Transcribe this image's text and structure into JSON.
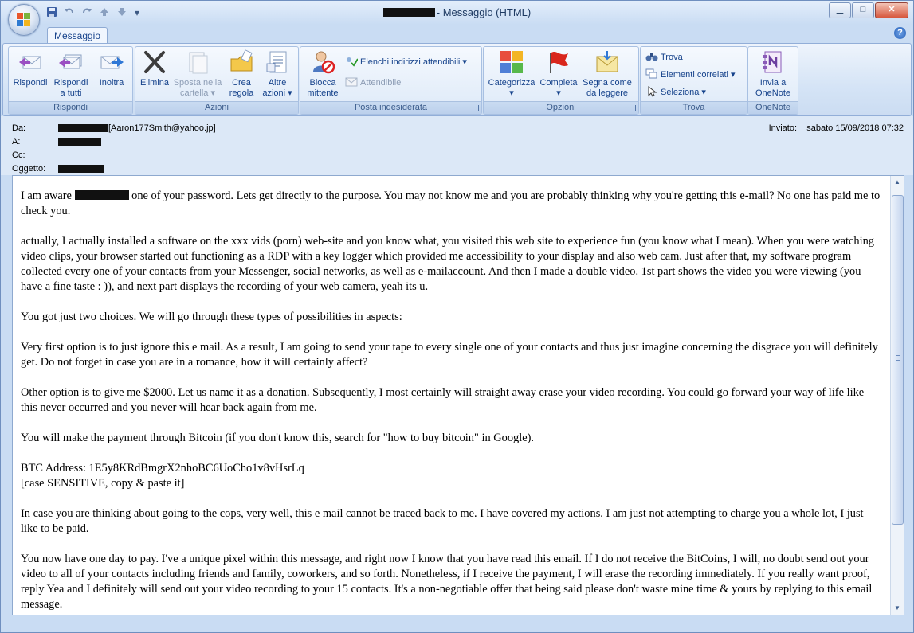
{
  "window": {
    "title": "- Messaggio (HTML)",
    "minimize": "▁",
    "maximize": "□",
    "close": "✕"
  },
  "quick_access": {
    "save_icon": "save-icon",
    "undo_icon": "undo-icon",
    "redo_icon": "redo-icon",
    "up_icon": "arrow-up-icon",
    "down_icon": "arrow-down-icon"
  },
  "tabs": [
    {
      "label": "Messaggio"
    }
  ],
  "ribbon": {
    "groups": {
      "rispondi": {
        "title": "Rispondi",
        "reply": "Rispondi",
        "reply_all_1": "Rispondi",
        "reply_all_2": "a tutti",
        "forward": "Inoltra"
      },
      "azioni": {
        "title": "Azioni",
        "delete": "Elimina",
        "move_1": "Sposta nella",
        "move_2": "cartella ▾",
        "rule_1": "Crea",
        "rule_2": "regola",
        "other_1": "Altre",
        "other_2": "azioni ▾"
      },
      "posta": {
        "title": "Posta indesiderata",
        "block_1": "Blocca",
        "block_2": "mittente",
        "safe_lists": "Elenchi indirizzi attendibili ▾",
        "trusted": "Attendibile"
      },
      "opzioni": {
        "title": "Opzioni",
        "categorize": "Categorizza",
        "categorize_arrow": "▾",
        "followup": "Completa",
        "followup_arrow": "▾",
        "mark_1": "Segna come",
        "mark_2": "da leggere"
      },
      "trova": {
        "title": "Trova",
        "find": "Trova",
        "related": "Elementi correlati ▾",
        "select": "Seleziona ▾"
      },
      "onenote": {
        "title": "OneNote",
        "send_1": "Invia a",
        "send_2": "OneNote"
      }
    }
  },
  "header": {
    "from_label": "Da:",
    "from_address": "[Aaron177Smith@yahoo.jp]",
    "to_label": "A:",
    "cc_label": "Cc:",
    "subject_label": "Oggetto:",
    "sent_label": "Inviato:",
    "sent_value": "sabato 15/09/2018 07:32"
  },
  "body": {
    "p1_a": "I am aware",
    "p1_b": "one of your password. Lets get directly to the purpose. You may not know me and you are probably thinking why you're getting this e-mail? No one has paid me to check you.",
    "p2": "actually, I actually installed a software on the xxx vids (porn) web-site and you know what, you visited this web site to experience fun (you know what I mean). When you were watching video clips, your browser started out functioning as a RDP with a key logger which provided me accessibility to your display and also web cam. Just after that, my software program collected every one of your contacts from your Messenger, social networks, as well as e-mailaccount. And then I made a double video. 1st part shows the video you were viewing (you have a fine taste : )), and next part displays the recording of your web camera, yeah its u.",
    "p3": "You got just two choices. We will go through these types of possibilities in aspects:",
    "p4": "Very first option is to just ignore this e mail. As a result, I am going to send your tape to every single one of your contacts and thus just imagine concerning the disgrace you will definitely get. Do not forget in case you are in a romance, how it will certainly affect?",
    "p5": "Other option is to give me $2000. Let us name it as a donation. Subsequently, I most certainly will straight away erase your video recording. You could go forward your way of life like this never occurred and you never will hear back again from me.",
    "p6": "You will make the payment through Bitcoin (if you don't know this, search for \"how to buy bitcoin\" in Google).",
    "p7a": "BTC Address: 1E5y8KRdBmgrX2nhoBC6UoCho1v8vHsrLq",
    "p7b": "[case SENSITIVE, copy & paste it]",
    "p8": "In case you are thinking about going to the cops, very well, this e mail cannot be traced back to me. I have covered my actions. I am just not attempting to charge you a whole lot, I just like to be paid.",
    "p9": "You now have one day to pay. I've a unique pixel within this message, and right now I know that you have read this email. If I do not receive the BitCoins, I will, no doubt send out your video to all of your contacts including friends and family, coworkers, and so forth. Nonetheless, if I receive the payment, I will erase the recording immediately. If you really want proof, reply Yea and I definitely will send out your video recording to your 15 contacts. It's a non-negotiable offer that being said please don't waste mine time & yours by replying to this email message."
  },
  "help_icon": "?"
}
